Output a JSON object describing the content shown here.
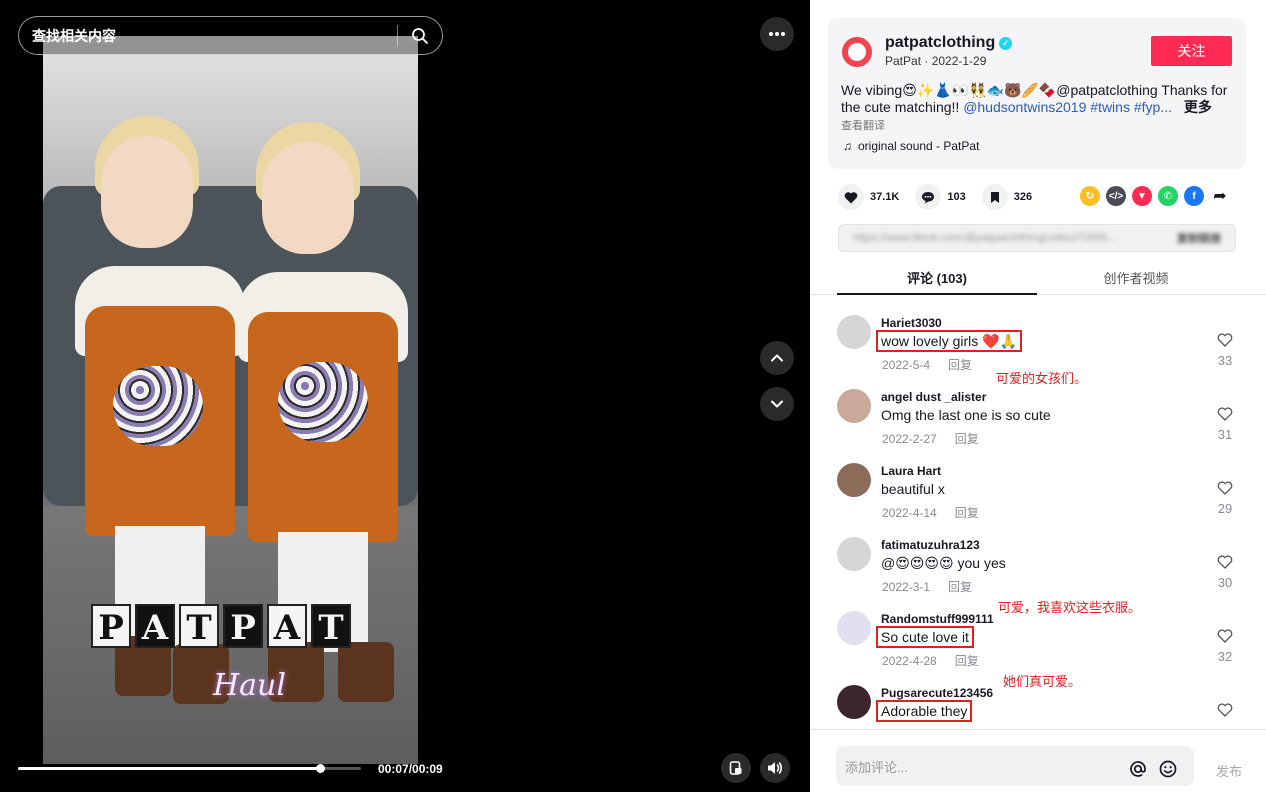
{
  "search": {
    "placeholder": "查找相关内容"
  },
  "video": {
    "overlay_letters": [
      "P",
      "A",
      "T",
      "P",
      "A",
      "T"
    ],
    "overlay_caption": "Haul",
    "time_display": "00:07/00:09",
    "progress": 0.88
  },
  "author": {
    "name": "patpatclothing",
    "sub": "PatPat · 2022-1-29",
    "follow_label": "关注"
  },
  "caption": {
    "text": "We vibing😍✨👗👀👯🐟🐻🥖🍫@patpatclothing Thanks for the cute matching!!",
    "mention": "@hudsontwins2019",
    "tags": "#twins #fyp...",
    "more_label": "更多",
    "translate_label": "查看翻译"
  },
  "sound": {
    "label": "original sound - PatPat"
  },
  "stats": {
    "likes": "37.1K",
    "comments": "103",
    "saves": "326"
  },
  "link": {
    "url": "https://www.tiktok.com/@patpatclothing/video/70555...",
    "copy_label": "复制链接"
  },
  "tabs": {
    "comments_label": "评论 (103)",
    "creator_videos_label": "创作者视频"
  },
  "comments": [
    {
      "user": "Hariet3030",
      "text": "wow lovely girls ❤️🙏",
      "date": "2022-5-4",
      "reply": "回复",
      "likes": "33",
      "note": "可爱的女孩们。",
      "boxed": true
    },
    {
      "user": "angel dust _alister",
      "text": "Omg the last one is so cute",
      "date": "2022-2-27",
      "reply": "回复",
      "likes": "31",
      "note": "",
      "boxed": false
    },
    {
      "user": "Laura Hart",
      "text": "beautiful x",
      "date": "2022-4-14",
      "reply": "回复",
      "likes": "29",
      "note": "",
      "boxed": false
    },
    {
      "user": "fatimatuzuhra123",
      "text": "@😍😍😍😍 you yes",
      "date": "2022-3-1",
      "reply": "回复",
      "likes": "30",
      "note": "",
      "boxed": false
    },
    {
      "user": "Randomstuff999111",
      "text": "So cute love it",
      "date": "2022-4-28",
      "reply": "回复",
      "likes": "32",
      "note": "可爱，我喜欢这些衣服。",
      "boxed": true
    },
    {
      "user": "Pugsarecute123456",
      "text": "Adorable they",
      "date": "",
      "reply": "",
      "likes": "",
      "note": "她们真可爱。",
      "boxed": true
    }
  ],
  "input": {
    "placeholder": "添加评论...",
    "post_label": "发布"
  },
  "colors": {
    "accent": "#fe2c55",
    "annotation": "#e02020",
    "link": "#2b5db9"
  }
}
